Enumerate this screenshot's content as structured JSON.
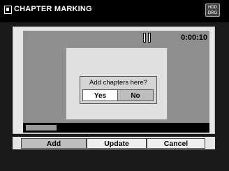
{
  "title": "CHAPTER MARKING",
  "badge": {
    "line1": "HDD",
    "line2": "DRG"
  },
  "status": {
    "state_icon": "pause-icon",
    "timecode": "0:00:10"
  },
  "dialog": {
    "prompt": "Add chapters here?",
    "yes_label": "Yes",
    "no_label": "No",
    "selected": "Yes"
  },
  "progress": {
    "fraction": 0.17
  },
  "buttons": {
    "add": "Add",
    "update": "Update",
    "cancel": "Cancel",
    "selected": "Add"
  }
}
